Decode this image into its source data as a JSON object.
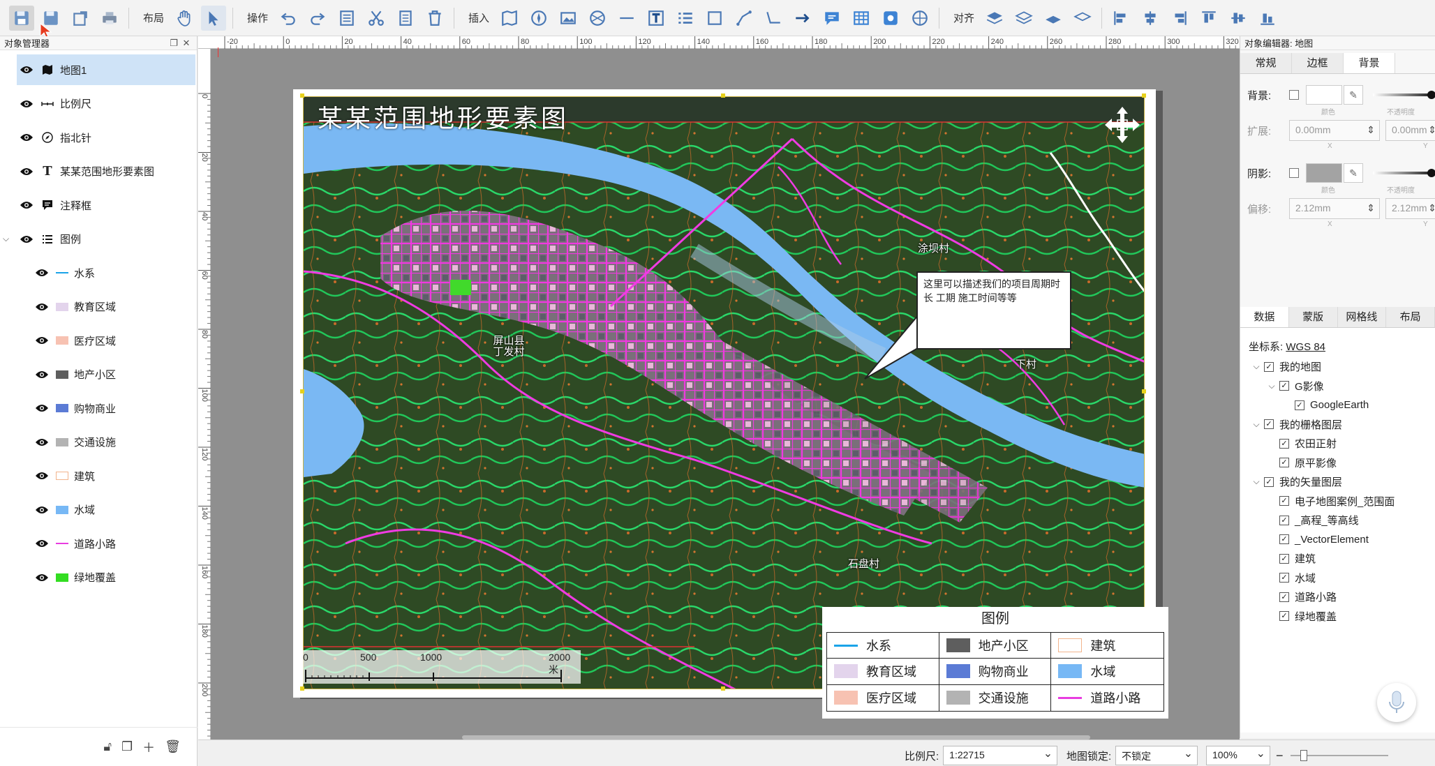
{
  "toolbar": {
    "layout_label": "布局",
    "operate_label": "操作",
    "insert_label": "插入",
    "align_label": "对齐"
  },
  "object_manager": {
    "title": "对象管理器",
    "items": [
      {
        "label": "地图1",
        "icon": "map-icon",
        "selected": true
      },
      {
        "label": "比例尺",
        "icon": "scalebar-icon"
      },
      {
        "label": "指北针",
        "icon": "compass-icon"
      },
      {
        "label": "某某范围地形要素图",
        "icon": "text-icon"
      },
      {
        "label": "注释框",
        "icon": "comment-icon"
      },
      {
        "label": "图例",
        "icon": "legend-icon",
        "expanded": true
      }
    ],
    "legend_children": [
      {
        "label": "水系",
        "kind": "line",
        "color": "#1aa3e8"
      },
      {
        "label": "教育区域",
        "kind": "fill",
        "color": "#e3d4ec"
      },
      {
        "label": "医疗区域",
        "kind": "fill",
        "color": "#f7c2b2"
      },
      {
        "label": "地产小区",
        "kind": "fill",
        "color": "#5e5e5e"
      },
      {
        "label": "购物商业",
        "kind": "fill",
        "color": "#5b7bd5"
      },
      {
        "label": "交通设施",
        "kind": "fill",
        "color": "#b3b3b3"
      },
      {
        "label": "建筑",
        "kind": "outline",
        "color": "#f2b48c"
      },
      {
        "label": "水域",
        "kind": "fill",
        "color": "#77b8f5"
      },
      {
        "label": "道路小路",
        "kind": "line",
        "color": "#e83ce0"
      },
      {
        "label": "绿地覆盖",
        "kind": "fill",
        "color": "#33dd22"
      }
    ]
  },
  "rulers": {
    "top_ticks": [
      "-20",
      "0",
      "20",
      "40",
      "60",
      "80",
      "100",
      "120",
      "140",
      "160",
      "180",
      "200",
      "220",
      "240",
      "260",
      "280",
      "300",
      "320"
    ],
    "left_ticks": [
      "0",
      "20",
      "40",
      "60",
      "80",
      "100",
      "120",
      "140",
      "160",
      "180",
      "200",
      "20"
    ]
  },
  "map": {
    "title": "某某范围地形要素图",
    "annotation": "这里可以描述我们的项目周期时长  工期 施工时间等等",
    "places": [
      {
        "name": "涂坝村"
      },
      {
        "name": "屏山县 丁发村"
      },
      {
        "name": "下村"
      },
      {
        "name": "石盘村"
      }
    ],
    "scalebar": {
      "labels": [
        "0",
        "500",
        "1000",
        "2000 米"
      ]
    }
  },
  "legend": {
    "title": "图例",
    "entries": [
      {
        "label": "水系",
        "kind": "line",
        "color": "#1aa3e8"
      },
      {
        "label": "地产小区",
        "kind": "fill",
        "color": "#5e5e5e"
      },
      {
        "label": "建筑",
        "kind": "outline",
        "color": "#f2b48c"
      },
      {
        "label": "教育区域",
        "kind": "fill",
        "color": "#e3d4ec"
      },
      {
        "label": "购物商业",
        "kind": "fill",
        "color": "#5b7bd5"
      },
      {
        "label": "水域",
        "kind": "fill",
        "color": "#77b8f5"
      },
      {
        "label": "医疗区域",
        "kind": "fill",
        "color": "#f7c2b2"
      },
      {
        "label": "交通设施",
        "kind": "fill",
        "color": "#b3b3b3"
      },
      {
        "label": "道路小路",
        "kind": "line",
        "color": "#e83ce0"
      }
    ]
  },
  "object_editor": {
    "title": "对象编辑器: 地图",
    "tabs": [
      "常规",
      "边框",
      "背景"
    ],
    "active_tab": "背景",
    "background_label": "背景:",
    "background_sub_color": "颜色",
    "background_sub_opacity": "不透明度",
    "extend_label": "扩展:",
    "extend_x": "0.00mm",
    "extend_y": "0.00mm",
    "shadow_label": "阴影:",
    "shadow_color": "#a3a3a3",
    "offset_label": "偏移:",
    "offset_x": "2.12mm",
    "offset_y": "2.12mm",
    "sub_x": "X",
    "sub_y": "Y",
    "cut_value": "1"
  },
  "data_panel": {
    "tabs": [
      "数据",
      "蒙版",
      "网格线",
      "布局"
    ],
    "active_tab": "数据",
    "crs_label": "坐标系:",
    "crs_value": "WGS 84",
    "layers": [
      {
        "label": "我的地图",
        "level": 0,
        "expander": "v"
      },
      {
        "label": "G影像",
        "level": 1,
        "expander": "v"
      },
      {
        "label": "GoogleEarth",
        "level": 2,
        "expander": ""
      },
      {
        "label": "我的栅格图层",
        "level": 0,
        "expander": "v"
      },
      {
        "label": "农田正射",
        "level": 1,
        "expander": ""
      },
      {
        "label": "原平影像",
        "level": 1,
        "expander": ""
      },
      {
        "label": "我的矢量图层",
        "level": 0,
        "expander": "v"
      },
      {
        "label": "电子地图案例_范围面",
        "level": 1,
        "expander": ""
      },
      {
        "label": "_高程_等高线",
        "level": 1,
        "expander": ""
      },
      {
        "label": "_VectorElement",
        "level": 1,
        "expander": ""
      },
      {
        "label": "建筑",
        "level": 1,
        "expander": ""
      },
      {
        "label": "水域",
        "level": 1,
        "expander": ""
      },
      {
        "label": "道路小路",
        "level": 1,
        "expander": ""
      },
      {
        "label": "绿地覆盖",
        "level": 1,
        "expander": ""
      }
    ]
  },
  "statusbar": {
    "scale_label": "比例尺:",
    "scale_value": "1:22715",
    "lock_label": "地图锁定:",
    "lock_value": "不锁定",
    "zoom_value": "100%"
  }
}
